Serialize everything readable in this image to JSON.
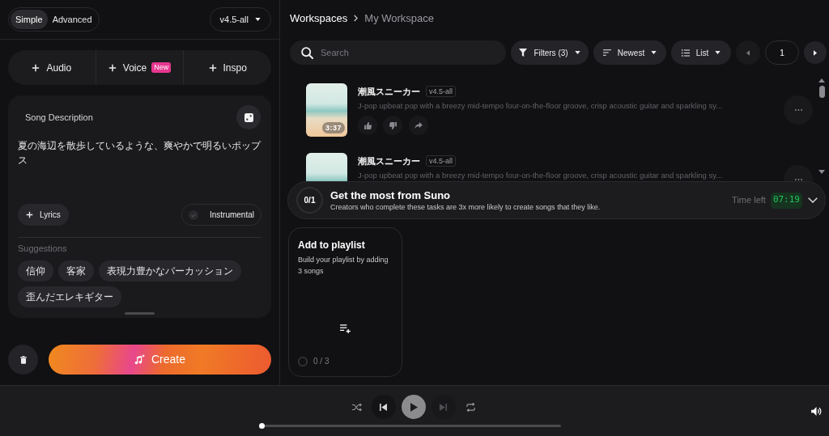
{
  "mode_toggle": [
    {
      "label": "Simple",
      "selected": true
    },
    {
      "label": "Advanced",
      "selected": false
    }
  ],
  "model_dropdown": {
    "value": "v4.5-all"
  },
  "add_buttons": [
    {
      "label": "Audio"
    },
    {
      "label": "Voice",
      "badge": "New"
    },
    {
      "label": "Inspo"
    }
  ],
  "song_description": {
    "label": "Song Description",
    "value": "夏の海辺を散歩しているような、爽やかで明るいポップス"
  },
  "lyrics_button": {
    "label": "Lyrics"
  },
  "instrumental": {
    "label": "Instrumental",
    "on": false
  },
  "suggestions": {
    "label": "Suggestions",
    "chips": [
      "信仰",
      "客家",
      "表現力豊かなパーカッション",
      "歪んだエレキギター"
    ]
  },
  "create_button": {
    "label": "Create"
  },
  "breadcrumb": [
    "Workspaces",
    "My Workspace"
  ],
  "search": {
    "placeholder": "Search"
  },
  "toolbar": [
    {
      "kind": "filter",
      "label": "Filters (3)"
    },
    {
      "kind": "sort",
      "label": "Newest"
    },
    {
      "kind": "view",
      "label": "List"
    }
  ],
  "pagination": {
    "page": "1"
  },
  "songs": [
    {
      "title": "潮風スニーカー",
      "version": "v4.5-all",
      "description": "J-pop upbeat pop with a breezy mid-tempo four-on-the-floor groove, crisp acoustic guitar and sparkling sy...",
      "duration": "3:37"
    },
    {
      "title": "潮風スニーカー",
      "version": "v4.5-all",
      "description": "J-pop upbeat pop with a breezy mid-tempo four-on-the-floor groove, crisp acoustic guitar and sparkling sy..."
    }
  ],
  "onboarding": {
    "progress": "0/1",
    "title": "Get the most from Suno",
    "subtitle": "Creators who complete these tasks are 3x more likely to create songs that they like.",
    "time_left_label": "Time left",
    "time_left": "07:19"
  },
  "tasks": [
    {
      "title": "Add to playlist",
      "description": "Build your playlist by adding 3 songs",
      "progress": "0 / 3",
      "done": false
    }
  ],
  "player": {
    "level": 0,
    "next_button": {
      "disabled": true
    }
  }
}
